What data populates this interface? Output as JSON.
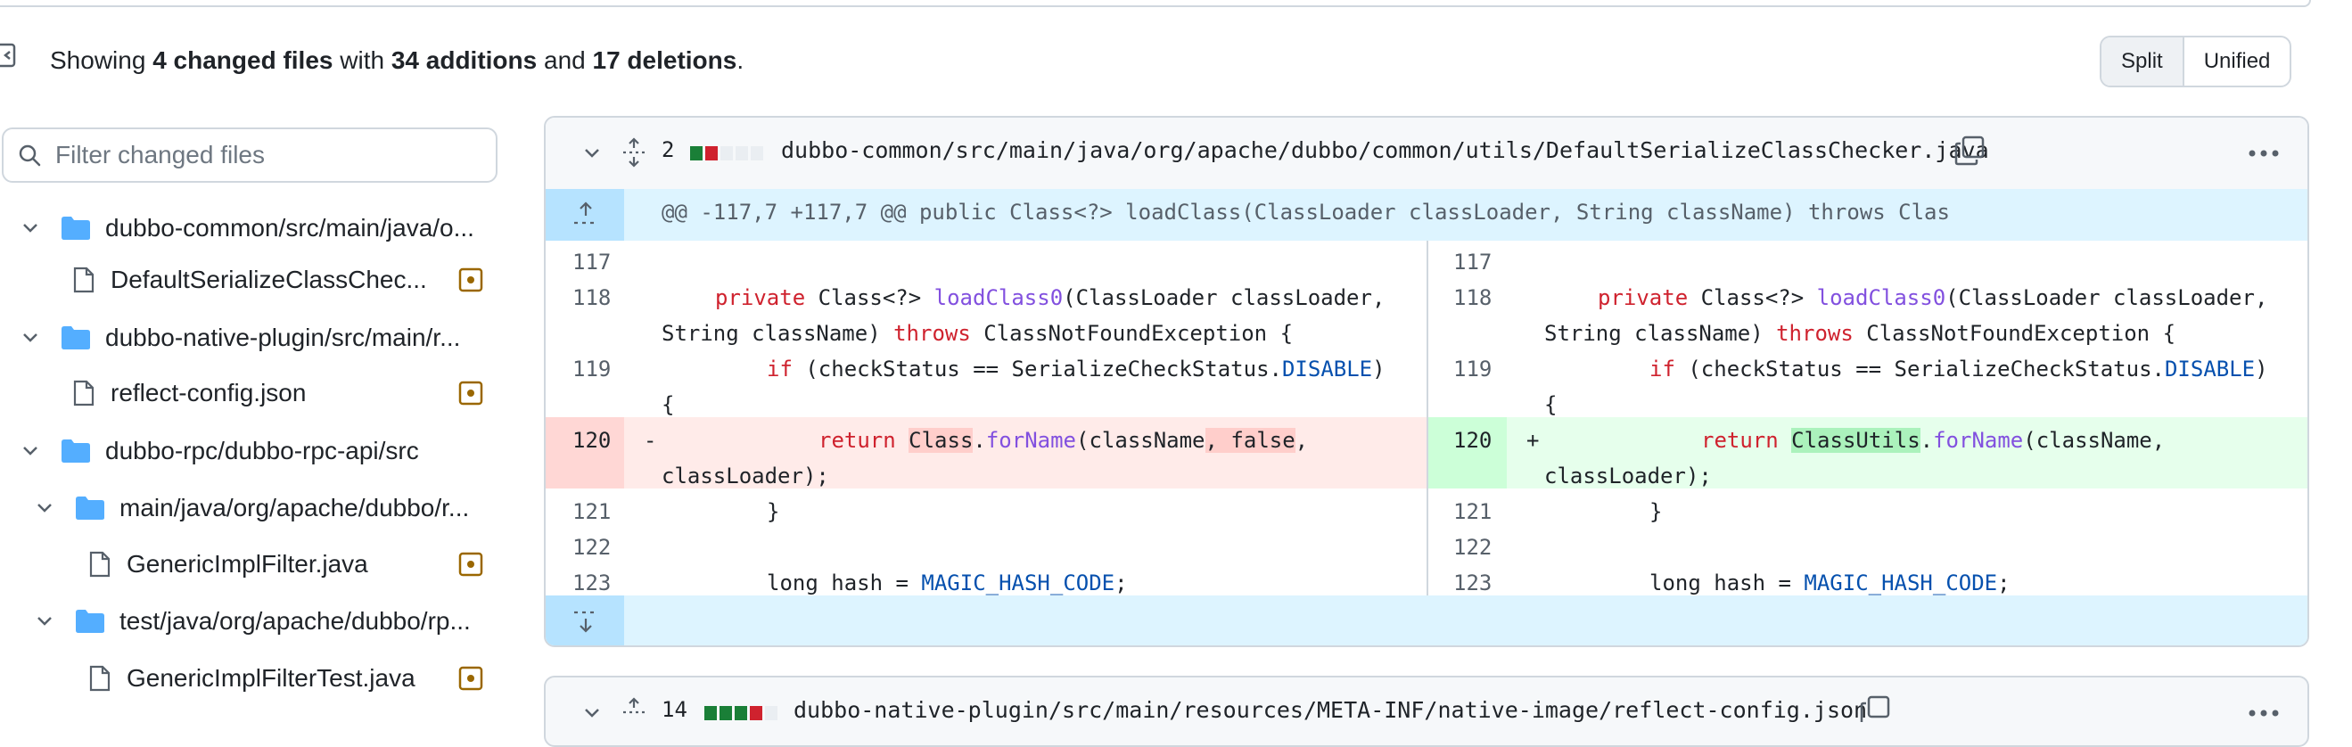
{
  "summary": {
    "prefix": "Showing ",
    "changed_files": "4 changed files",
    "with": " with ",
    "additions": "34 additions",
    "and": " and ",
    "deletions": "17 deletions",
    "end": "."
  },
  "view_toggle": {
    "split": "Split",
    "unified": "Unified",
    "selected": "Split"
  },
  "filter": {
    "placeholder": "Filter changed files"
  },
  "tree": [
    {
      "type": "folder",
      "label": "dubbo-common/src/main/java/o...",
      "icon": "folder-icon"
    },
    {
      "type": "file",
      "label": "DefaultSerializeClassChec...",
      "icon": "file-icon",
      "status": "modified"
    },
    {
      "type": "folder",
      "label": "dubbo-native-plugin/src/main/r...",
      "icon": "folder-icon"
    },
    {
      "type": "file",
      "label": "reflect-config.json",
      "icon": "file-icon",
      "status": "modified"
    },
    {
      "type": "folder",
      "label": "dubbo-rpc/dubbo-rpc-api/src",
      "icon": "folder-icon"
    },
    {
      "type": "folder",
      "label": "main/java/org/apache/dubbo/r...",
      "icon": "folder-icon"
    },
    {
      "type": "file",
      "label": "GenericImplFilter.java",
      "icon": "file-icon",
      "status": "modified"
    },
    {
      "type": "folder",
      "label": "test/java/org/apache/dubbo/rp...",
      "icon": "folder-icon"
    },
    {
      "type": "file",
      "label": "GenericImplFilterTest.java",
      "icon": "file-icon",
      "status": "modified"
    }
  ],
  "file1": {
    "changes": "2",
    "path": "dubbo-common/src/main/java/org/apache/dubbo/common/utils/DefaultSerializeClassChecker.java",
    "hunk_header": "@@ -117,7 +117,7 @@ public Class<?> loadClass(ClassLoader classLoader, String className) throws Clas",
    "line_numbers": [
      "117",
      "118",
      "119",
      "120",
      "121",
      "122",
      "123"
    ],
    "left": {
      "l118a": "private",
      "l118b": " Class<?> ",
      "l118c": "loadClass0",
      "l118d": "(ClassLoader classLoader,",
      "l118e": "String className) ",
      "l118f": "throws",
      "l118g": " ClassNotFoundException {",
      "l119a": "if",
      "l119b": " (checkStatus == SerializeCheckStatus.",
      "l119c": "DISABLE",
      "l119d": ")",
      "l119e": "{",
      "l120sign": "-",
      "l120a": "return",
      "l120b": "Class",
      "l120c": ".",
      "l120d": "forName",
      "l120e": "(className",
      "l120f": ", false",
      "l120g": ",",
      "l120h": "classLoader);",
      "l121": "}",
      "l123a": "long hash = ",
      "l123b": "MAGIC_HASH_CODE",
      "l123c": ";"
    },
    "right": {
      "l120sign": "+",
      "l120b": "ClassUtils",
      "l120e": "(className,",
      "l120h": "classLoader);"
    }
  },
  "file2": {
    "changes": "14",
    "path": "dubbo-native-plugin/src/main/resources/META-INF/native-image/reflect-config.json"
  }
}
